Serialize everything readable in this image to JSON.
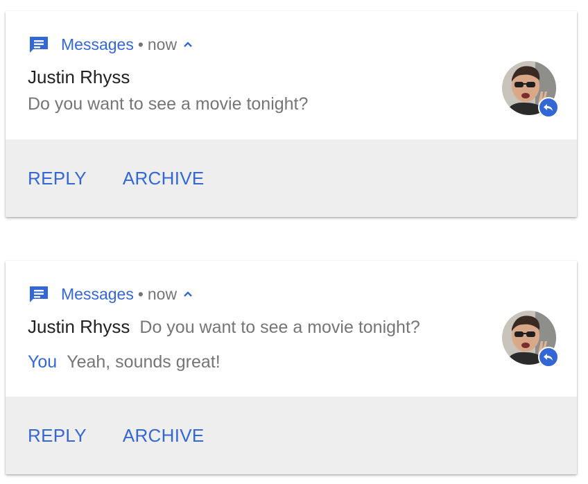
{
  "colors": {
    "accent": "#3367d6",
    "secondary_text": "#757575",
    "primary_text": "#212121",
    "actions_bg": "#eeeeee"
  },
  "notifications": [
    {
      "app_icon": "messages-icon",
      "app_name": "Messages",
      "separator": "•",
      "time": "now",
      "expand_icon": "chevron-up-icon",
      "sender": "Justin Rhyss",
      "message": "Do you want to see a movie tonight?",
      "avatar_icon": "avatar-photo",
      "badge_icon": "reply-icon",
      "actions": [
        "REPLY",
        "ARCHIVE"
      ]
    },
    {
      "app_icon": "messages-icon",
      "app_name": "Messages",
      "separator": "•",
      "time": "now",
      "expand_icon": "chevron-up-icon",
      "sender": "Justin Rhyss",
      "message": "Do you want to see a movie tonight?",
      "reply_sender": "You",
      "reply_message": "Yeah, sounds great!",
      "avatar_icon": "avatar-photo",
      "badge_icon": "reply-icon",
      "actions": [
        "REPLY",
        "ARCHIVE"
      ]
    }
  ]
}
